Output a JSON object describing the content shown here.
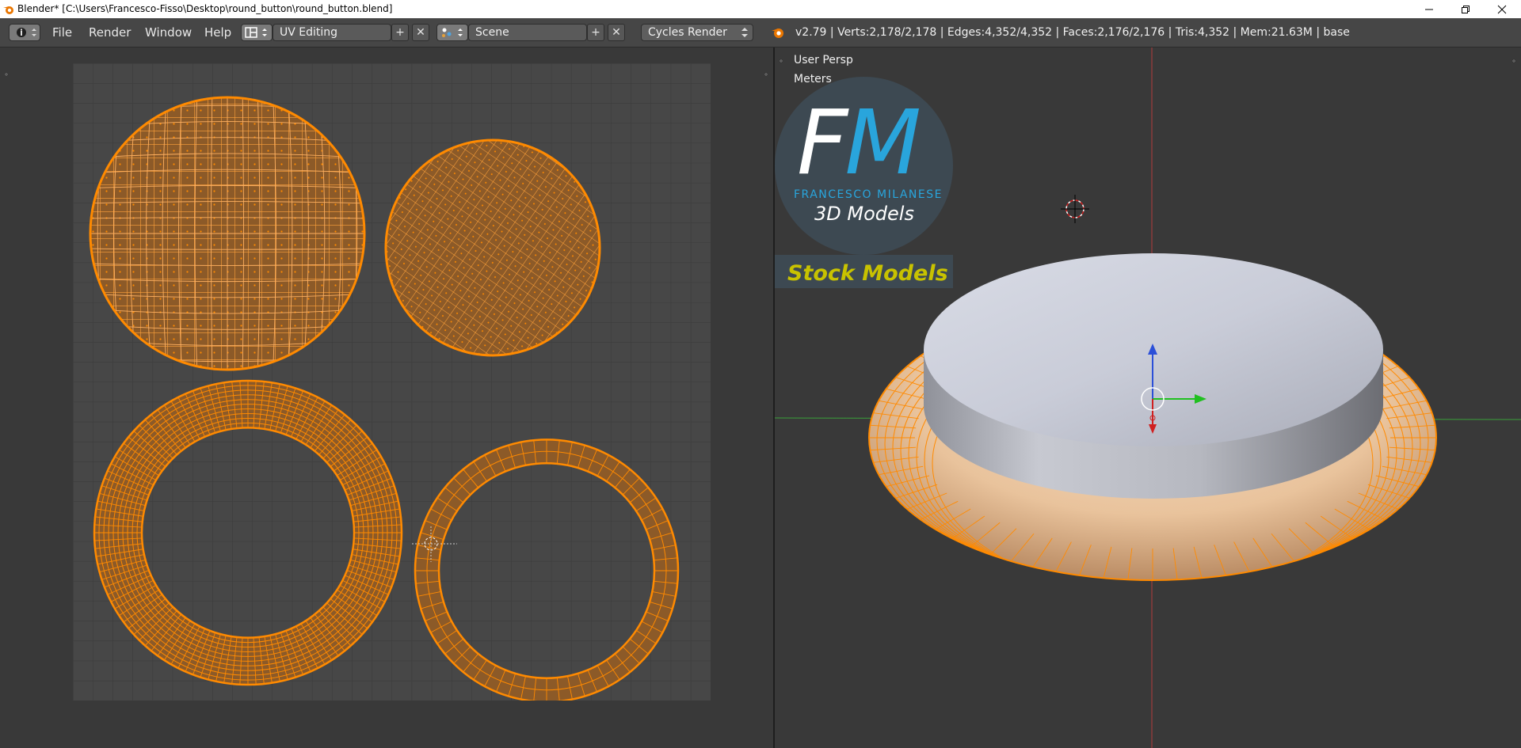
{
  "window": {
    "title": "Blender* [C:\\Users\\Francesco-Fisso\\Desktop\\round_button\\round_button.blend]",
    "icons": [
      "blender-logo-icon",
      "minimize-icon",
      "restore-icon",
      "close-icon"
    ]
  },
  "header": {
    "menus": [
      "File",
      "Render",
      "Window",
      "Help"
    ],
    "screen_layout": "UV Editing",
    "scene": "Scene",
    "render_engine": "Cycles Render",
    "stats": "v2.79 | Verts:2,178/2,178 | Edges:4,352/4,352 | Faces:2,176/2,176 | Tris:4,352 | Mem:21.63M | base",
    "icons": [
      "info-editor-icon",
      "layout-icon",
      "scene-icon",
      "add-icon",
      "remove-icon",
      "render-engine-icon"
    ]
  },
  "uv_editor": {
    "islands": [
      "top-left-disc",
      "top-right-disc",
      "bottom-left-ring",
      "bottom-right-ring"
    ]
  },
  "viewport": {
    "view_label": "User Persp",
    "units_label": "Meters",
    "logo": {
      "letters_f": "F",
      "letters_m": "M",
      "name": "FRANCESCO MILANESE",
      "subtitle": "3D Models",
      "banner": "Stock Models"
    }
  },
  "colors": {
    "uv_edge": "#ff8a00",
    "uv_fill": "#8c5a28",
    "background": "#393939",
    "grid_bg": "#474747",
    "logo_blue": "#29a5dc",
    "banner_yellow": "#c8c200"
  }
}
